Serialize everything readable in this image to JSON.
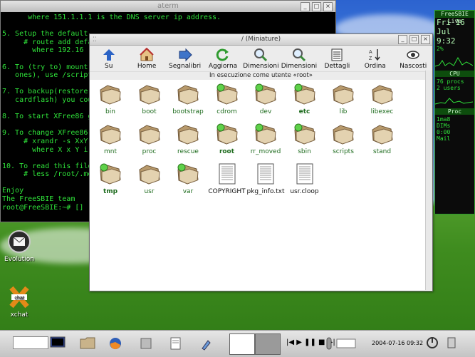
{
  "terminal": {
    "title": "aterm",
    "lines": [
      "      where 151.1.1.1 is the DNS server ip address.",
      "",
      "5. Setup the default",
      "     # route add defau",
      "       where 192.16",
      "",
      "6. To (try to) mount",
      "   ones), use /script",
      "",
      "7. To backup(restore)",
      "   cardflash) you cou",
      "",
      "8. To start XFree86 g",
      "",
      "9. To change XFree86",
      "     # xrandr -s XxY",
      "       where X x Y i",
      "",
      "10. To read this file",
      "     # less /root/.me",
      "",
      "Enjoy",
      "The FreeSBIE team",
      "root@FreeSBIE:~# []"
    ]
  },
  "file_manager": {
    "title": "/ (Miniature)",
    "user_line": "In esecuzione come utente «root»",
    "toolbar": [
      {
        "label": "Su",
        "icon": "up-arrow-icon"
      },
      {
        "label": "Home",
        "icon": "home-icon"
      },
      {
        "label": "Segnalibri",
        "icon": "bookmarks-icon"
      },
      {
        "label": "Aggiorna",
        "icon": "refresh-icon"
      },
      {
        "label": "Dimensioni",
        "icon": "zoom-in-icon"
      },
      {
        "label": "Dimensioni",
        "icon": "zoom-out-icon"
      },
      {
        "label": "Dettagli",
        "icon": "details-icon"
      },
      {
        "label": "Ordina",
        "icon": "sort-icon"
      },
      {
        "label": "Nascosti",
        "icon": "eye-icon"
      }
    ],
    "items": [
      {
        "name": "bin",
        "type": "folder"
      },
      {
        "name": "boot",
        "type": "folder"
      },
      {
        "name": "bootstrap",
        "type": "folder"
      },
      {
        "name": "cdrom",
        "type": "folder",
        "mounted": true
      },
      {
        "name": "dev",
        "type": "folder",
        "mounted": true
      },
      {
        "name": "etc",
        "type": "folder",
        "mounted": true,
        "bold": true
      },
      {
        "name": "lib",
        "type": "folder"
      },
      {
        "name": "libexec",
        "type": "folder"
      },
      {
        "name": "mnt",
        "type": "folder"
      },
      {
        "name": "proc",
        "type": "folder"
      },
      {
        "name": "rescue",
        "type": "folder"
      },
      {
        "name": "root",
        "type": "folder",
        "mounted": true,
        "bold": true
      },
      {
        "name": "rr_moved",
        "type": "folder",
        "mounted": true
      },
      {
        "name": "sbin",
        "type": "folder",
        "mounted": true
      },
      {
        "name": "scripts",
        "type": "folder"
      },
      {
        "name": "stand",
        "type": "folder"
      },
      {
        "name": "tmp",
        "type": "folder",
        "mounted": true,
        "bold": true
      },
      {
        "name": "usr",
        "type": "folder"
      },
      {
        "name": "var",
        "type": "folder",
        "mounted": true
      },
      {
        "name": "COPYRIGHT",
        "type": "file"
      },
      {
        "name": "pkg_info.txt",
        "type": "file"
      },
      {
        "name": "usr.cloop",
        "type": "file"
      }
    ]
  },
  "desktop_icons": [
    {
      "label": "Evolution",
      "icon": "evolution-icon"
    },
    {
      "label": "xchat",
      "icon": "xchat-icon"
    }
  ],
  "monitor": {
    "title": "FreeSBIE Live",
    "date": "Fri 16 Jul",
    "time": "9:32",
    "cpu_label": "CPU",
    "cpu_percent": "2%",
    "procs": "76 procs",
    "users": "2 users",
    "proc_label": "Proc",
    "mem1": "1ma8",
    "mem2": "DIMs",
    "uptime": "0:00",
    "mail": "Mail"
  },
  "taskbar": {
    "clock": "2004-07-16 09:32",
    "media_controls": "|◀ ▶ ❚❚ ■ ▶|"
  }
}
